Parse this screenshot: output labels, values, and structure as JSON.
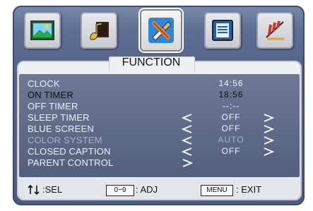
{
  "menu": {
    "title": "FUNCTION",
    "items": [
      {
        "label": "CLOCK",
        "value": "14:56",
        "state": "normal",
        "has_left": false,
        "has_right": false
      },
      {
        "label": "ON TIMER",
        "value": "18:56",
        "state": "active",
        "has_left": false,
        "has_right": false
      },
      {
        "label": "OFF TIMER",
        "value": "--:--",
        "state": "normal",
        "has_left": false,
        "has_right": false
      },
      {
        "label": "SLEEP TIMER",
        "value": "OFF",
        "state": "normal",
        "has_left": true,
        "has_right": true
      },
      {
        "label": "BLUE SCREEN",
        "value": "OFF",
        "state": "normal",
        "has_left": true,
        "has_right": true
      },
      {
        "label": "COLOR SYSTEM",
        "value": "AUTO",
        "state": "disabled",
        "has_left": true,
        "has_right": true
      },
      {
        "label": "CLOSED CAPTION",
        "value": "OFF",
        "state": "normal",
        "has_left": true,
        "has_right": true
      },
      {
        "label": "PARENT CONTROL",
        "value": "",
        "state": "normal",
        "has_left": true,
        "has_right": false
      }
    ]
  },
  "footer": {
    "sel_text": ":SEL",
    "adj_key": "0~9",
    "adj_text": ": ADJ",
    "exit_key": "MENU",
    "exit_text": ": EXIT"
  },
  "icons": {
    "tabs": [
      {
        "name": "picture-icon",
        "selected": false
      },
      {
        "name": "music-note-icon",
        "selected": false
      },
      {
        "name": "tools-icon",
        "selected": true
      },
      {
        "name": "screen-setup-icon",
        "selected": false
      },
      {
        "name": "antenna-icon",
        "selected": false
      }
    ],
    "arrow_left": "left-arrow-icon",
    "arrow_right": "right-arrow-icon",
    "updown": "up-down-arrows-icon"
  },
  "colors": {
    "frame": "#5f6f92",
    "panel": "#e2e5ea",
    "content": "#5f6b8a",
    "text": "#eef0ff",
    "active_text": "#111111",
    "disabled_text": "#a8b0c4"
  }
}
